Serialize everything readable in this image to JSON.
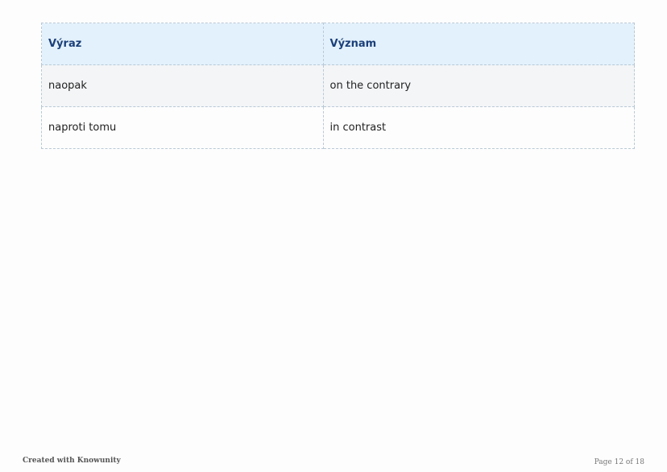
{
  "table": {
    "headers": [
      "Výraz",
      "Význam"
    ],
    "rows": [
      [
        "naopak",
        "on the contrary"
      ],
      [
        "naproti tomu",
        "in contrast"
      ]
    ]
  },
  "footer": {
    "credit": "Created with Knowunity",
    "page_indicator": "Page 12 of 18"
  },
  "colors": {
    "header_background": "#e3f1fc",
    "header_text": "#1b3f78",
    "row_shade": "#f3f5f7",
    "border": "#b9c9d6"
  }
}
